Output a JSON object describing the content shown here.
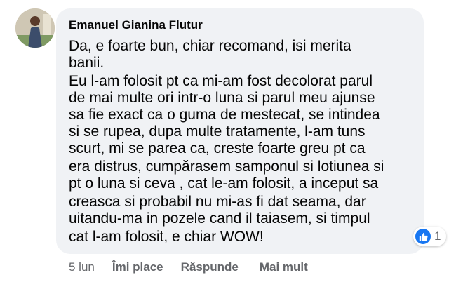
{
  "comment": {
    "author": "Emanuel Gianina Flutur",
    "lines": [
      "Da, e foarte bun, chiar recomand, isi merita",
      "banii.",
      "Eu l-am folosit pt ca mi-am fost decolorat parul",
      "de mai multe ori intr-o luna si parul meu ajunse",
      "sa fie exact ca o guma de mestecat, se intindea",
      "si se rupea, dupa multe tratamente, l-am tuns",
      "scurt, mi se parea ca, creste foarte greu pt ca",
      "era distrus, cumpărasem samponul si lotiunea si",
      "pt o luna si ceva , cat le-am folosit, a inceput sa",
      "creasca si probabil nu mi-as fi dat seama, dar",
      "uitandu-ma in pozele cand il taiasem, si timpul",
      "cat l-am folosit, e chiar WOW!"
    ],
    "reaction": {
      "icon": "like-icon",
      "count": "1",
      "color": "#1877f2"
    }
  },
  "actions": {
    "time": "5 lun",
    "like": "Îmi place",
    "reply": "Răspunde",
    "more": "Mai mult"
  },
  "colors": {
    "bubble": "#f0f2f5",
    "text": "#050505",
    "secondary": "#65676b",
    "accent": "#1877f2"
  }
}
